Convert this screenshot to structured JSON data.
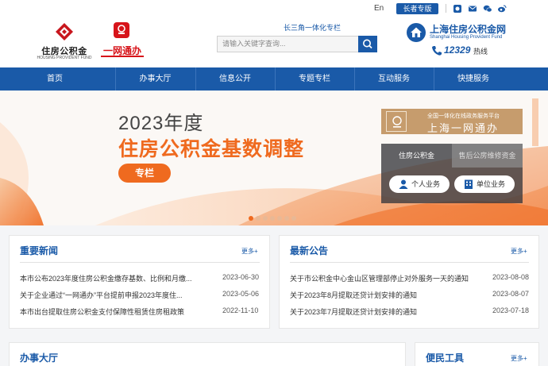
{
  "topbar": {
    "lang": "En",
    "elder_mode": "长者专版",
    "icons": [
      "app-icon",
      "mail-icon",
      "wechat-icon",
      "weibo-icon"
    ]
  },
  "header": {
    "logo1": {
      "name": "住房公积金",
      "en": "HOUSING PROVIDENT FUND"
    },
    "logo2": {
      "name": "一网通办"
    },
    "yrd_link": "长三角一体化专栏",
    "search": {
      "placeholder": "请输入关键字查询..."
    },
    "brand": {
      "cn": "上海住房公积金网",
      "en": "Shanghai Housing Provident Fund"
    },
    "hotline": {
      "number": "12329",
      "label": "热线"
    }
  },
  "nav": {
    "items": [
      "首页",
      "办事大厅",
      "信息公开",
      "专题专栏",
      "互动服务",
      "快捷服务"
    ]
  },
  "banner": {
    "year": "2023年度",
    "headline": "住房公积金基数调整",
    "tag": "专栏",
    "ywtb_small": "全国一体化在线政务服务平台",
    "ywtb_big": "上海一网通办",
    "tabs": [
      "住房公积金",
      "售后公房维修资金"
    ],
    "buttons": [
      "个人业务",
      "单位业务"
    ]
  },
  "news": {
    "title": "重要新闻",
    "more": "更多+",
    "items": [
      {
        "text": "本市公布2023年度住房公积金缴存基数、比例和月缴...",
        "date": "2023-06-30"
      },
      {
        "text": "关于企业通过“一网通办”平台提前申报2023年度住...",
        "date": "2023-05-06"
      },
      {
        "text": "本市出台提取住房公积金支付保障性租赁住房租政策",
        "date": "2022-11-10"
      }
    ]
  },
  "notices": {
    "title": "最新公告",
    "more": "更多+",
    "items": [
      {
        "text": "关于市公积金中心金山区管理部停止对外服务一天的通知",
        "date": "2023-08-08"
      },
      {
        "text": "关于2023年8月提取还贷计划安排的通知",
        "date": "2023-08-07"
      },
      {
        "text": "关于2023年7月提取还贷计划安排的通知",
        "date": "2023-07-18"
      }
    ]
  },
  "hall": {
    "title": "办事大厅"
  },
  "tools": {
    "title": "便民工具",
    "more": "更多+"
  },
  "colors": {
    "brand_blue": "#1a5aa8",
    "accent_orange": "#ef6a1f",
    "gold": "#c69c6d"
  }
}
